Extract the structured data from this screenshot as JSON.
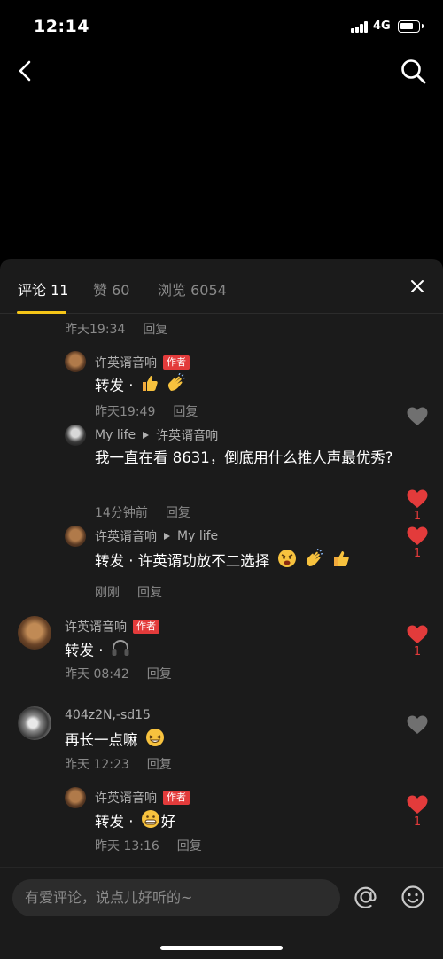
{
  "status_bar": {
    "time": "12:14",
    "network": "4G"
  },
  "tabs": [
    {
      "label": "评论 11"
    },
    {
      "label": "赞 60"
    },
    {
      "label": "浏览 6054"
    }
  ],
  "reply_label": "回复",
  "author_badge": "作者",
  "comments": [
    {
      "time": "昨天19:34"
    },
    {
      "user": "许英谞音响",
      "badge": "作者",
      "text": "转发 ·",
      "time": "昨天19:49",
      "likes": ""
    },
    {
      "user": "My life",
      "reply_to": "许英谞音响",
      "text": "我一直在看 8631，倒底用什么推人声最优秀?",
      "time": "14分钟前",
      "likes": "1"
    },
    {
      "user": "许英谞音响",
      "reply_to": "My life",
      "text": "转发 · 许英谞功放不二选择",
      "time": "刚刚",
      "likes": "1"
    },
    {
      "user": "许英谞音响",
      "badge": "作者",
      "text": "转发 ·",
      "time": "昨天 08:42",
      "likes": "1"
    },
    {
      "user": "404z2N,-sd15",
      "text": "再长一点嘛",
      "time": "昨天 12:23",
      "likes": ""
    },
    {
      "user": "许英谞音响",
      "badge": "作者",
      "text": "转发 · ",
      "text_suffix": "好",
      "time": "昨天 13:16",
      "likes": "1"
    }
  ],
  "input": {
    "placeholder": "有爱评论，说点儿好听的~"
  },
  "colors": {
    "background": "#000000",
    "sheet": "#1b1b1b",
    "accent": "#f5c518",
    "like": "#e33b3b",
    "muted": "#8a8a8a"
  }
}
